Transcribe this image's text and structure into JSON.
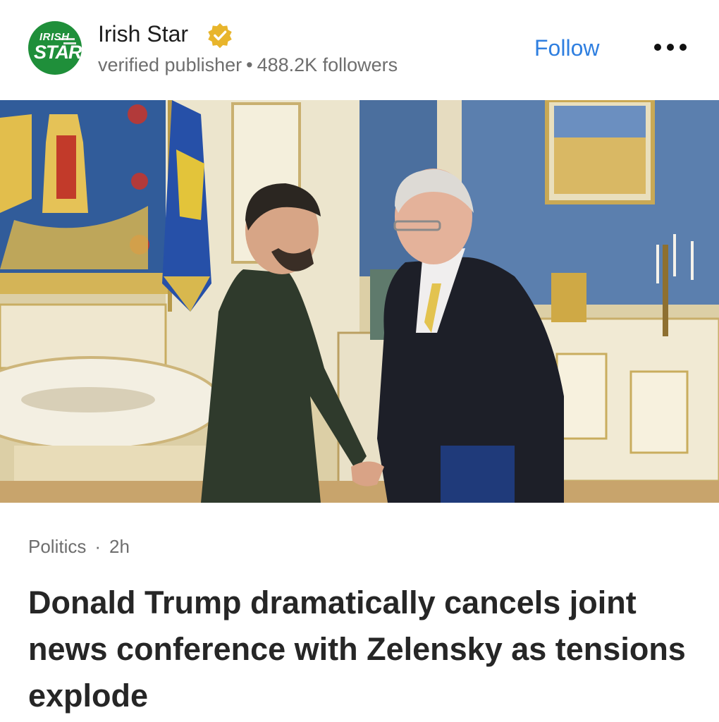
{
  "publisher": {
    "logo_text_top": "IRISH",
    "logo_text_bottom": "STAR",
    "name": "Irish Star",
    "status": "verified publisher",
    "separator": "•",
    "followers": "488.2K followers",
    "follow_label": "Follow",
    "more_icon": "more-horizontal-icon",
    "verified_icon": "verified-badge-icon"
  },
  "article": {
    "category": "Politics",
    "separator": "·",
    "time": "2h",
    "headline": "Donald Trump dramatically cancels joint news conference with Zelensky as tensions explode"
  },
  "colors": {
    "accent": "#2f7fe0",
    "logo_green": "#1f8f3a",
    "verified_gold": "#e8b52c"
  }
}
